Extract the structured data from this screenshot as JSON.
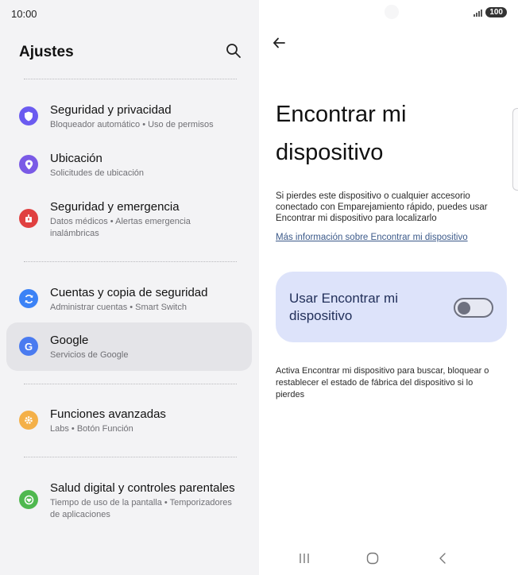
{
  "status": {
    "time": "10:00",
    "battery": "100"
  },
  "left": {
    "title": "Ajustes",
    "items": [
      {
        "title": "Seguridad y privacidad",
        "subtitle": "Bloqueador automático • Uso de permisos",
        "icon": "shield-icon",
        "color": "#6b5bf0"
      },
      {
        "title": "Ubicación",
        "subtitle": "Solicitudes de ubicación",
        "icon": "location-pin-icon",
        "color": "#7a5ae6"
      },
      {
        "title": "Seguridad y emergencia",
        "subtitle": "Datos médicos • Alertas emergencia inalámbricas",
        "icon": "emergency-icon",
        "color": "#e04040"
      },
      {
        "title": "Cuentas y copia de seguridad",
        "subtitle": "Administrar cuentas • Smart Switch",
        "icon": "sync-icon",
        "color": "#3b82f6"
      },
      {
        "title": "Google",
        "subtitle": "Servicios de Google",
        "icon": "google-icon",
        "color": "#4a7bf0"
      },
      {
        "title": "Funciones avanzadas",
        "subtitle": "Labs • Botón Función",
        "icon": "gear-icon",
        "color": "#f4b048"
      },
      {
        "title": "Salud digital y controles parentales",
        "subtitle": "Tiempo de uso de la pantalla • Temporizadores de aplicaciones",
        "icon": "digital-wellbeing-icon",
        "color": "#4fb84f"
      }
    ]
  },
  "right": {
    "title": "Encontrar mi dispositivo",
    "description": "Si pierdes este dispositivo o cualquier accesorio conectado con Emparejamiento rápido, puedes usar Encontrar mi dispositivo para localizarlo",
    "link": "Más información sobre Encontrar mi dispositivo",
    "toggle_label": "Usar Encontrar mi dispositivo",
    "toggle_on": false,
    "footer": "Activa Encontrar mi dispositivo para buscar, bloquear o restablecer el estado de fábrica del dispositivo si lo pierdes"
  }
}
